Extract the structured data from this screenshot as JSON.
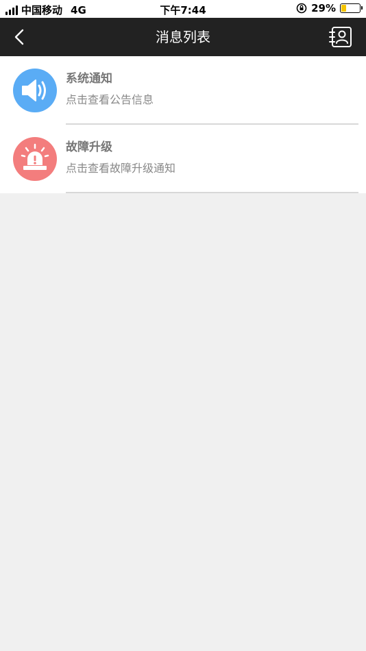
{
  "status_bar": {
    "carrier": "中国移动",
    "network": "4G",
    "time": "下午7:44",
    "battery_percent": "29%",
    "battery_level": 0.29
  },
  "nav": {
    "title": "消息列表",
    "back_icon": "chevron-left-icon",
    "contacts_icon": "contact-book-icon"
  },
  "messages": [
    {
      "title": "系统通知",
      "subtitle": "点击查看公告信息",
      "icon": "speaker-icon",
      "color": "#5aacf5"
    },
    {
      "title": "故障升级",
      "subtitle": "点击查看故障升级通知",
      "icon": "alarm-light-icon",
      "color": "#f37d7d"
    }
  ],
  "colors": {
    "nav_background": "#222222",
    "page_background": "#f0f0f0"
  }
}
